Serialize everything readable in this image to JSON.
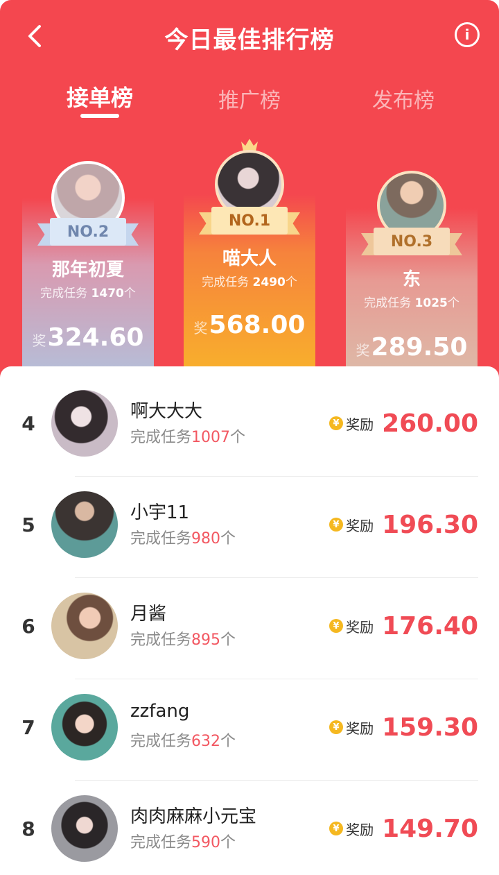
{
  "header": {
    "title": "今日最佳排行榜",
    "back_icon": "back-arrow-icon",
    "info_icon": "info-icon",
    "info_glyph": "i"
  },
  "tabs": [
    {
      "label": "接单榜",
      "active": true
    },
    {
      "label": "推广榜",
      "active": false
    },
    {
      "label": "发布榜",
      "active": false
    }
  ],
  "podium": {
    "first": {
      "badge": "NO.1",
      "name": "喵大人",
      "task_prefix": "完成任务",
      "count": "2490",
      "unit": "个",
      "prize_label": "奖",
      "prize": "568.00"
    },
    "second": {
      "badge": "NO.2",
      "name": "那年初夏",
      "task_prefix": "完成任务",
      "count": "1470",
      "unit": "个",
      "prize_label": "奖",
      "prize": "324.60"
    },
    "third": {
      "badge": "NO.3",
      "name": "东",
      "task_prefix": "完成任务",
      "count": "1025",
      "unit": "个",
      "prize_label": "奖",
      "prize": "289.50"
    }
  },
  "list": [
    {
      "rank": "4",
      "name": "啊大大大",
      "task_prefix": "完成任务",
      "count": "1007",
      "unit": "个",
      "reward_label": "奖励",
      "reward": "260.00"
    },
    {
      "rank": "5",
      "name": "小宇11",
      "task_prefix": "完成任务",
      "count": "980",
      "unit": "个",
      "reward_label": "奖励",
      "reward": "196.30"
    },
    {
      "rank": "6",
      "name": "月酱",
      "task_prefix": "完成任务",
      "count": "895",
      "unit": "个",
      "reward_label": "奖励",
      "reward": "176.40"
    },
    {
      "rank": "7",
      "name": "zzfang",
      "task_prefix": "完成任务",
      "count": "632",
      "unit": "个",
      "reward_label": "奖励",
      "reward": "159.30"
    },
    {
      "rank": "8",
      "name": "肉肉麻麻小元宝",
      "task_prefix": "完成任务",
      "count": "590",
      "unit": "个",
      "reward_label": "奖励",
      "reward": "149.70"
    }
  ],
  "coin_glyph": "¥",
  "colors": {
    "accent": "#f4474f",
    "reward": "#f04b55",
    "coin": "#f5b820"
  }
}
